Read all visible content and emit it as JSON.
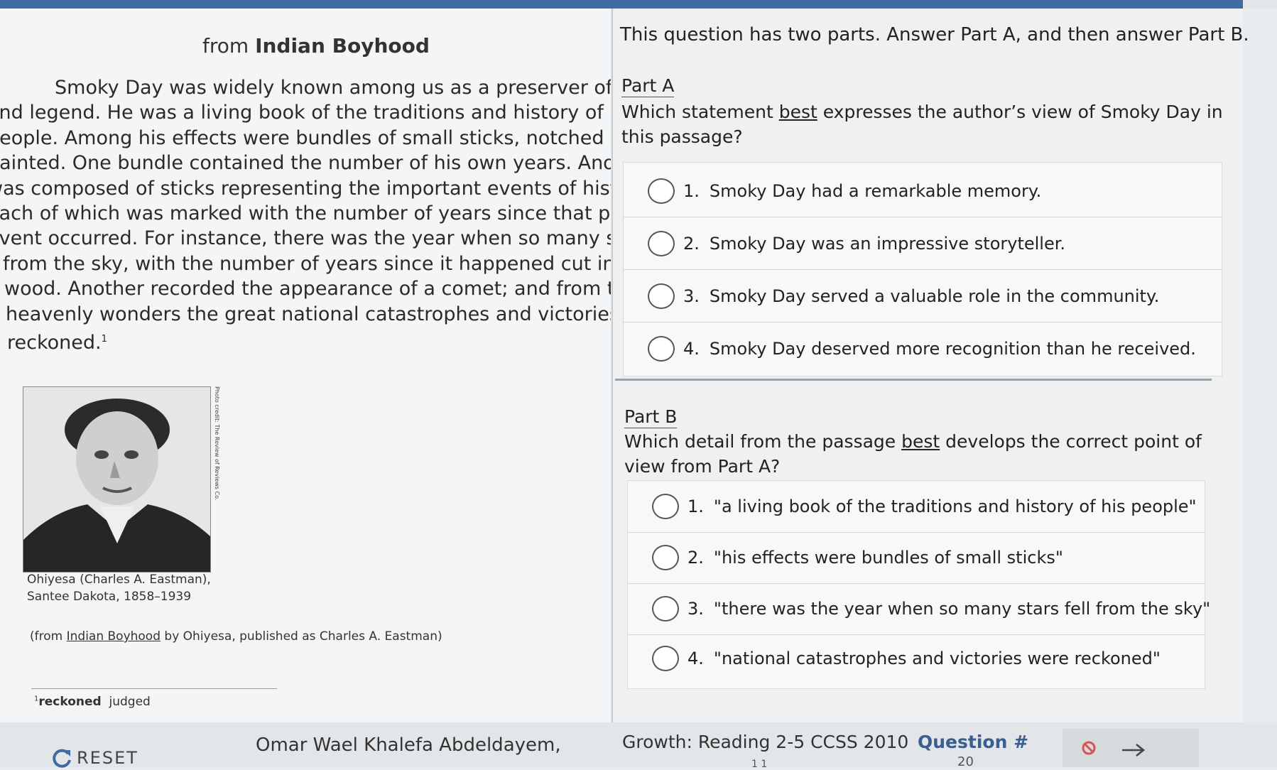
{
  "passage": {
    "title_prefix": "from ",
    "title_bold": "Indian Boyhood",
    "lines": [
      "Smoky Day was widely known among us as a preserver of history",
      "and legend. He was a living book of the traditions and history of his",
      "people. Among his effects were bundles of small sticks, notched and",
      "painted. One bundle contained the number of his own years. Another",
      "was composed of sticks representing the important events of history,",
      "each of which was marked with the number of years since that particular",
      "event occurred. For instance, there was the year when so many stars fell",
      "from the sky, with the number of years since it happened cut into the",
      "wood. Another recorded the appearance of a comet; and from these",
      "heavenly wonders the great national catastrophes and victories were",
      "reckoned."
    ],
    "footnote_marker": "1",
    "photo_credit": "Photo credit: The Review of Reviews Co.",
    "caption_line1": "Ohiyesa (Charles A. Eastman),",
    "caption_line2": "Santee Dakota, 1858–1939",
    "source_prefix": "(from ",
    "source_title": "Indian Boyhood",
    "source_suffix": " by Ohiyesa, published as Charles A. Eastman)",
    "footnote_num": "1",
    "footnote_term": "reckoned",
    "footnote_def": "judged"
  },
  "question": {
    "instruction": "This question has two parts. Answer Part A, and then answer Part B.",
    "part_a": {
      "label": "Part A",
      "prompt_before": "Which statement ",
      "prompt_emph": "best",
      "prompt_after": " expresses the author’s view of Smoky Day in",
      "prompt_line2": "this passage?",
      "choices": [
        {
          "num": "1.",
          "text": "Smoky Day had a remarkable memory."
        },
        {
          "num": "2.",
          "text": "Smoky Day was an impressive storyteller."
        },
        {
          "num": "3.",
          "text": "Smoky Day served a valuable role in the community."
        },
        {
          "num": "4.",
          "text": "Smoky Day deserved more recognition than he received."
        }
      ]
    },
    "part_b": {
      "label": "Part B",
      "prompt_before": "Which detail from the passage ",
      "prompt_emph": "best",
      "prompt_after": " develops the correct point of",
      "prompt_line2": "view from Part A?",
      "choices": [
        {
          "num": "1.",
          "text": "\"a living book of the traditions and history of his people\""
        },
        {
          "num": "2.",
          "text": "\"his effects were bundles of small sticks\""
        },
        {
          "num": "3.",
          "text": "\"there was the year when so many stars fell from the sky\""
        },
        {
          "num": "4.",
          "text": "\"national catastrophes and victories were reckoned\""
        }
      ]
    }
  },
  "footer": {
    "reset_label": "RESET",
    "student_name": "Omar Wael Khalefa Abdeldayem,",
    "test_name": "Growth: Reading 2-5 CCSS 2010",
    "question_label": "Question #",
    "question_number": "20",
    "student_suffix": "1 1"
  },
  "colors": {
    "accent": "#3f6aa2",
    "question_label": "#3a5f8f",
    "block_icon": "#d9534f"
  },
  "icons": {
    "reset": "refresh-icon",
    "block": "no-entry-icon",
    "next": "arrow-right-icon"
  }
}
